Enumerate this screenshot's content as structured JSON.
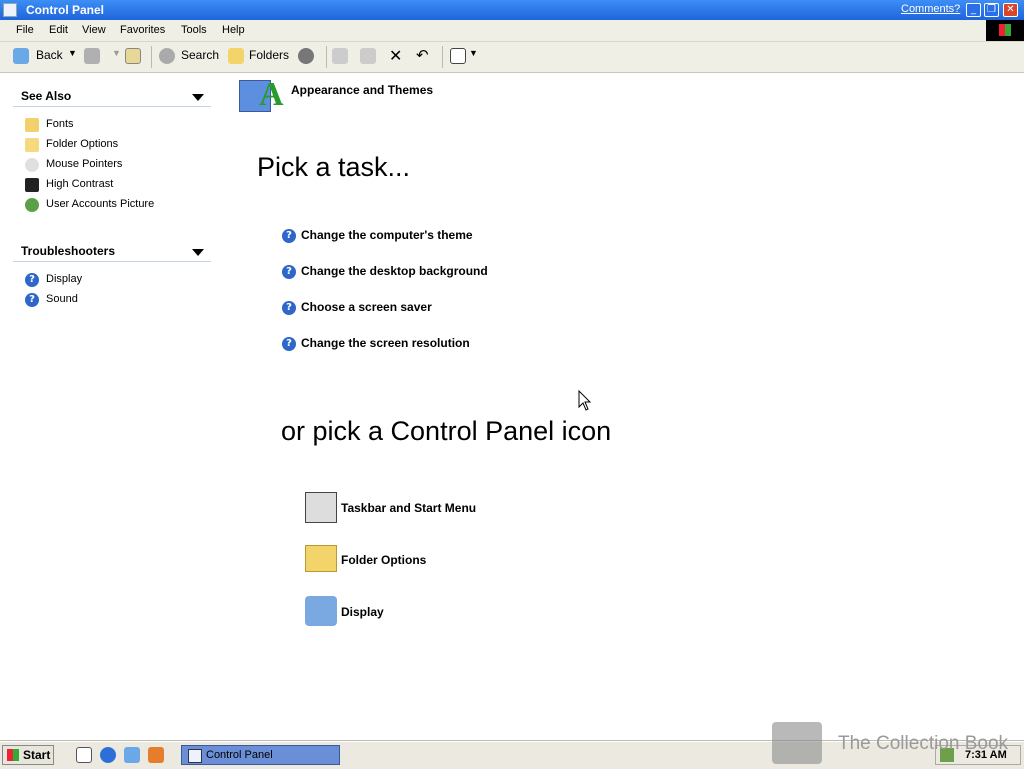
{
  "window": {
    "title": "Control Panel",
    "comments_link": "Comments?"
  },
  "menu": [
    "File",
    "Edit",
    "View",
    "Favorites",
    "Tools",
    "Help"
  ],
  "toolbar": {
    "back": "Back",
    "search": "Search",
    "folders": "Folders"
  },
  "see_also": {
    "heading": "See Also",
    "items": [
      "Fonts",
      "Folder Options",
      "Mouse Pointers",
      "High Contrast",
      "User Accounts Picture"
    ]
  },
  "troubleshooters": {
    "heading": "Troubleshooters",
    "items": [
      "Display",
      "Sound"
    ]
  },
  "category_title": "Appearance and Themes",
  "pick_task_heading": "Pick a task...",
  "tasks": [
    "Change the computer's theme",
    "Change the desktop background",
    "Choose a screen saver",
    "Change the screen resolution"
  ],
  "pick_icon_heading": "or pick a Control Panel icon",
  "icons": [
    "Taskbar and Start Menu",
    "Folder Options",
    "Display"
  ],
  "taskbar": {
    "start": "Start",
    "task_button": "Control Panel",
    "clock": "7:31 AM"
  },
  "watermark": "The Collection Book",
  "colors": {
    "titlebar": "#2a6fe8",
    "taskbutton": "#6b8fd6",
    "help_icon": "#2e67c9"
  }
}
